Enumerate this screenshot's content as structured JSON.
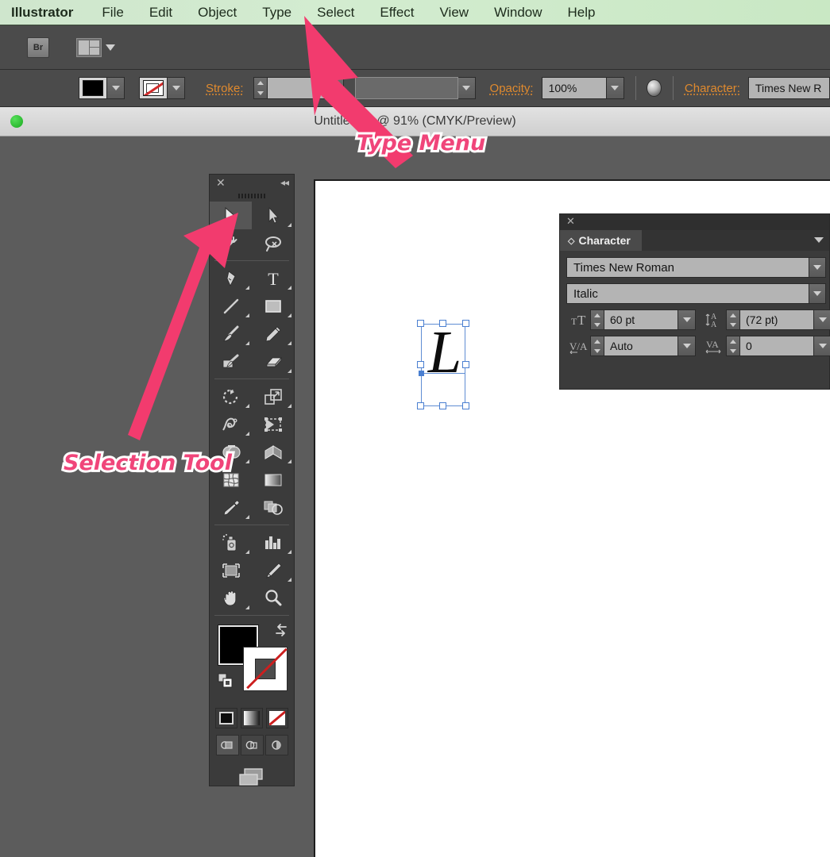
{
  "app": {
    "name": "Illustrator"
  },
  "menubar": {
    "items": [
      {
        "label": "Illustrator",
        "bold": true
      },
      {
        "label": "File"
      },
      {
        "label": "Edit"
      },
      {
        "label": "Object"
      },
      {
        "label": "Type"
      },
      {
        "label": "Select"
      },
      {
        "label": "Effect"
      },
      {
        "label": "View"
      },
      {
        "label": "Window"
      },
      {
        "label": "Help"
      }
    ]
  },
  "topstrip": {
    "bridge_label": "Br",
    "arrange_icon": "arrange-documents-icon"
  },
  "controlbar": {
    "fill_swatch": "black",
    "stroke_swatch": "none",
    "stroke_label": "Stroke:",
    "stroke_weight": "",
    "stroke_profile": "",
    "opacity_label": "Opacity:",
    "opacity_value": "100%",
    "character_label": "Character:",
    "character_font": "Times New R"
  },
  "titlebar": {
    "doc_title": "Untitled-1* @ 91% (CMYK/Preview)",
    "status_dot_color": "#2cc431"
  },
  "tools_panel": {
    "close_glyph": "✕",
    "collapse_glyph": "◂◂",
    "groups": [
      [
        {
          "name": "selection-tool",
          "active": true,
          "has_flyout": false
        },
        {
          "name": "direct-selection-tool",
          "active": false,
          "has_flyout": true
        },
        {
          "name": "magic-wand-tool",
          "active": false,
          "has_flyout": false
        },
        {
          "name": "lasso-tool",
          "active": false,
          "has_flyout": false
        }
      ],
      [
        {
          "name": "pen-tool",
          "active": false,
          "has_flyout": true
        },
        {
          "name": "type-tool",
          "active": false,
          "has_flyout": true
        },
        {
          "name": "line-segment-tool",
          "active": false,
          "has_flyout": true
        },
        {
          "name": "rectangle-tool",
          "active": false,
          "has_flyout": true
        },
        {
          "name": "paintbrush-tool",
          "active": false,
          "has_flyout": true
        },
        {
          "name": "pencil-tool",
          "active": false,
          "has_flyout": true
        },
        {
          "name": "blob-brush-tool",
          "active": false,
          "has_flyout": false
        },
        {
          "name": "eraser-tool",
          "active": false,
          "has_flyout": true
        }
      ],
      [
        {
          "name": "rotate-tool",
          "active": false,
          "has_flyout": true
        },
        {
          "name": "scale-tool",
          "active": false,
          "has_flyout": true
        },
        {
          "name": "width-tool",
          "active": false,
          "has_flyout": true
        },
        {
          "name": "free-transform-tool",
          "active": false,
          "has_flyout": false
        },
        {
          "name": "shape-builder-tool",
          "active": false,
          "has_flyout": true
        },
        {
          "name": "perspective-grid-tool",
          "active": false,
          "has_flyout": true
        },
        {
          "name": "mesh-tool",
          "active": false,
          "has_flyout": false
        },
        {
          "name": "gradient-tool",
          "active": false,
          "has_flyout": false
        },
        {
          "name": "eyedropper-tool",
          "active": false,
          "has_flyout": true
        },
        {
          "name": "blend-tool",
          "active": false,
          "has_flyout": false
        }
      ],
      [
        {
          "name": "symbol-sprayer-tool",
          "active": false,
          "has_flyout": true
        },
        {
          "name": "column-graph-tool",
          "active": false,
          "has_flyout": true
        },
        {
          "name": "artboard-tool",
          "active": false,
          "has_flyout": false
        },
        {
          "name": "slice-tool",
          "active": false,
          "has_flyout": true
        },
        {
          "name": "hand-tool",
          "active": false,
          "has_flyout": true
        },
        {
          "name": "zoom-tool",
          "active": false,
          "has_flyout": false
        }
      ]
    ],
    "fill_color": "#000000",
    "stroke_color": "none",
    "paint_modes": [
      "color-button",
      "gradient-button",
      "none-button"
    ],
    "draw_modes": [
      "draw-normal-button",
      "draw-behind-button",
      "draw-inside-button"
    ],
    "screen_mode": "change-screen-mode-button"
  },
  "character_panel": {
    "close_glyph": "✕",
    "tab_label": "Character",
    "tab_diamond": "◇",
    "font_family": "Times New Roman",
    "font_style": "Italic",
    "font_size": "60 pt",
    "leading": "(72 pt)",
    "kerning": "Auto",
    "tracking": "0",
    "icons": {
      "font_size": "font-size-icon",
      "leading": "leading-icon",
      "kerning": "kerning-icon",
      "tracking": "tracking-icon"
    }
  },
  "canvas": {
    "selected_text": "L",
    "selection_handle_color": "#4a7fd1"
  },
  "annotations": [
    {
      "id": "type-menu",
      "label": "Type Menu"
    },
    {
      "id": "selection-tool",
      "label": "Selection Tool"
    }
  ],
  "colors": {
    "menubar_green": "#cfe6cd",
    "panel_gray": "#3b3b3b",
    "chrome_gray": "#4b4b4b",
    "workspace_gray": "#5c5c5c",
    "accent_orange": "#e08a2e",
    "annotation_pink": "#f0457a",
    "arrow_pink": "#f23b6e"
  }
}
